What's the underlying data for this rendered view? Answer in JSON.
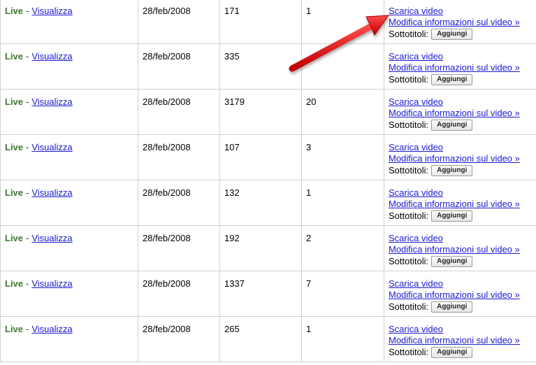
{
  "rows": [
    {
      "status": "Live",
      "sep": "-",
      "view_link": "Visualizza",
      "date": "28/feb/2008",
      "views": "171",
      "comments": "1",
      "download_link": "Scarica video",
      "edit_link": "Modifica informazioni sul video »",
      "subtitles_label": "Sottotitoli:",
      "add_button": "Aggiungi"
    },
    {
      "status": "Live",
      "sep": "-",
      "view_link": "Visualizza",
      "date": "28/feb/2008",
      "views": "335",
      "comments": "",
      "download_link": "Scarica video",
      "edit_link": "Modifica informazioni sul video »",
      "subtitles_label": "Sottotitoli:",
      "add_button": "Aggiungi"
    },
    {
      "status": "Live",
      "sep": "-",
      "view_link": "Visualizza",
      "date": "28/feb/2008",
      "views": "3179",
      "comments": "20",
      "download_link": "Scarica video",
      "edit_link": "Modifica informazioni sul video »",
      "subtitles_label": "Sottotitoli:",
      "add_button": "Aggiungi"
    },
    {
      "status": "Live",
      "sep": "-",
      "view_link": "Visualizza",
      "date": "28/feb/2008",
      "views": "107",
      "comments": "3",
      "download_link": "Scarica video",
      "edit_link": "Modifica informazioni sul video »",
      "subtitles_label": "Sottotitoli:",
      "add_button": "Aggiungi"
    },
    {
      "status": "Live",
      "sep": "-",
      "view_link": "Visualizza",
      "date": "28/feb/2008",
      "views": "132",
      "comments": "1",
      "download_link": "Scarica video",
      "edit_link": "Modifica informazioni sul video »",
      "subtitles_label": "Sottotitoli:",
      "add_button": "Aggiungi"
    },
    {
      "status": "Live",
      "sep": "-",
      "view_link": "Visualizza",
      "date": "28/feb/2008",
      "views": "192",
      "comments": "2",
      "download_link": "Scarica video",
      "edit_link": "Modifica informazioni sul video »",
      "subtitles_label": "Sottotitoli:",
      "add_button": "Aggiungi"
    },
    {
      "status": "Live",
      "sep": "-",
      "view_link": "Visualizza",
      "date": "28/feb/2008",
      "views": "1337",
      "comments": "7",
      "download_link": "Scarica video",
      "edit_link": "Modifica informazioni sul video »",
      "subtitles_label": "Sottotitoli:",
      "add_button": "Aggiungi"
    },
    {
      "status": "Live",
      "sep": "-",
      "view_link": "Visualizza",
      "date": "28/feb/2008",
      "views": "265",
      "comments": "1",
      "download_link": "Scarica video",
      "edit_link": "Modifica informazioni sul video »",
      "subtitles_label": "Sottotitoli:",
      "add_button": "Aggiungi"
    }
  ],
  "colors": {
    "status": "#3d7a2d",
    "link": "#1a1ad0",
    "grid": "#d0d0d0",
    "annotation_arrow": "#e01010"
  },
  "annotation": {
    "icon": "red-arrow-icon"
  }
}
